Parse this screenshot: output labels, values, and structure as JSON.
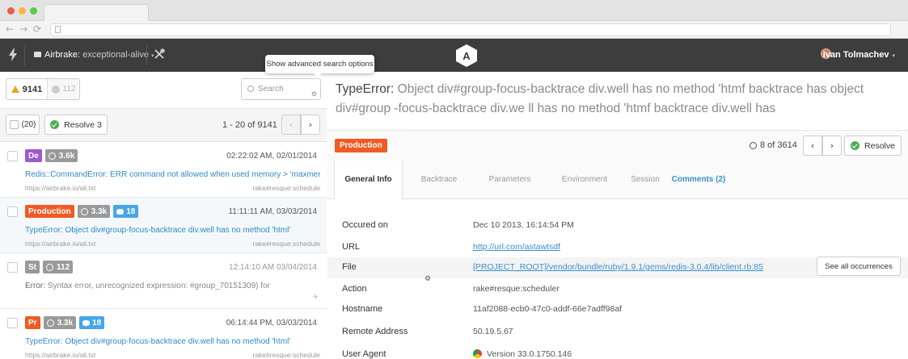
{
  "browser": {
    "back_glyph": "←",
    "forward_glyph": "→",
    "reload_glyph": "⟳"
  },
  "header": {
    "project_name": "Airbrake:",
    "project_env": "exceptional-alive",
    "caret": "▾",
    "user_name": "Ivan Tolmachev",
    "logo_letter": "A",
    "tooltip": "Show advanced search options"
  },
  "filters": {
    "open_count": "9141",
    "resolved_count": "112",
    "search_placeholder": "Search",
    "select_count": "(20)",
    "resolve_label": "Resolve 3",
    "pagination": "1 - 20 of 9141",
    "prev_glyph": "‹",
    "next_glyph": "›"
  },
  "errors": [
    {
      "env_badge": "De",
      "env_color": "#9c59d1",
      "count": "3.6k",
      "comments": "",
      "time": "02:22:02 AM, 02/01/2014",
      "type": "Redis::CommandError:",
      "message": "ERR command not allowed when used memory > 'maxmemory'",
      "source": "https://airbrake.io/ali.txt",
      "job": "rake#resque:schedule"
    },
    {
      "env_badge": "Production",
      "env_color": "#f05a23",
      "count": "3.3k",
      "comments": "18",
      "time": "11:11:11 AM, 03/03/2014",
      "type": "TypeError:",
      "message": "Object div#group-focus-backtrace div.well has no method 'html'",
      "source": "https://airbrake.io/ali.txt",
      "job": "rake#resque:schedule"
    },
    {
      "env_badge": "St",
      "env_color": "#999999",
      "count": "112",
      "comments": "",
      "time": "12:14:10 AM 03/04/2014",
      "type": "Error:",
      "message": "Syntax error, unrecognized expression: #group_70151309) for",
      "source": "",
      "job": ""
    },
    {
      "env_badge": "Pr",
      "env_color": "#f05a23",
      "count": "3.3k",
      "comments": "18",
      "time": "06:14:44 PM, 03/03/2014",
      "type": "TypeError:",
      "message": "Object div#group-focus-backtrace div.well has no method 'html'",
      "source": "https://airbrake.io/ali.txt",
      "job": "rake#resque:schedule"
    }
  ],
  "detail": {
    "error_type": "TypeError:",
    "error_message": "Object div#group-focus-backtrace div.well has no method 'htmf backtrace has object div#group -focus-backtrace div.we ll has no method 'htmf backtrace div.well has",
    "environment": "Production",
    "occurrence": "8 of 3614",
    "resolve_label": "Resolve",
    "prev_glyph": "‹",
    "next_glyph": "›",
    "tabs": [
      "General Info",
      "Backtrace",
      "Parameters",
      "Environment",
      "Session",
      "Comments (2)"
    ],
    "properties": [
      {
        "label": "Occured on",
        "value": "Dec 10 2013, 16:14:54 PM"
      },
      {
        "label": "URL",
        "value": "http://url.com/astawtsdf"
      },
      {
        "label": "File",
        "value": "[PROJECT_ROOT]/vendor/bundle/ruby/1.9.1/gems/redis-3.0.4/lib/client.rb:85"
      },
      {
        "label": "Action",
        "value": "rake#resque:scheduler"
      },
      {
        "label": "Hostname",
        "value": "11af2088-ecb0-47c0-addf-66e7adff98af"
      },
      {
        "label": "Remote Address",
        "value": "50.19.5.67"
      },
      {
        "label": "User Agent",
        "value": "Version 33.0.1750.146"
      }
    ],
    "see_all_label": "See all occurrences"
  },
  "colors": {
    "header_bg": "#3d3d3d",
    "accent_orange": "#f05a23",
    "link_blue": "#3a8fd1",
    "resolve_green": "#4caf50"
  }
}
